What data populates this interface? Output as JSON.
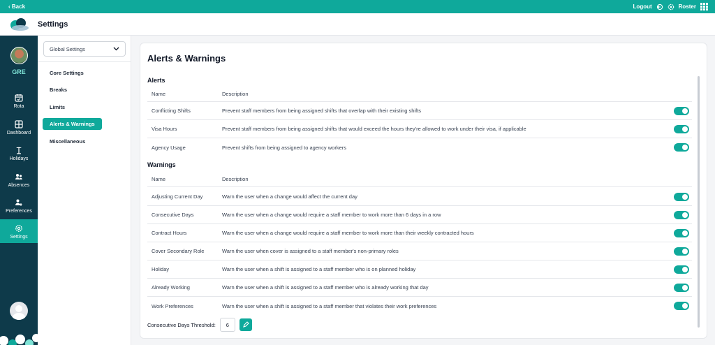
{
  "topbar": {
    "back_label": "Back",
    "logout_label": "Logout",
    "roster_label": "Roster"
  },
  "header": {
    "title": "Settings"
  },
  "nav": {
    "site_code": "GRE",
    "items": [
      {
        "label": "Rota",
        "icon": "calendar-icon"
      },
      {
        "label": "Dashboard",
        "icon": "dashboard-icon"
      },
      {
        "label": "Holidays",
        "icon": "holiday-icon"
      },
      {
        "label": "Absences",
        "icon": "absences-icon"
      },
      {
        "label": "Preferences",
        "icon": "preferences-icon"
      },
      {
        "label": "Settings",
        "icon": "gear-icon",
        "active": true
      }
    ]
  },
  "subnav": {
    "select_value": "Global Settings",
    "items": [
      {
        "label": "Core Settings"
      },
      {
        "label": "Breaks"
      },
      {
        "label": "Limits"
      },
      {
        "label": "Alerts & Warnings",
        "active": true
      },
      {
        "label": "Miscellaneous"
      }
    ]
  },
  "page": {
    "title": "Alerts & Warnings",
    "col_name": "Name",
    "col_description": "Description",
    "alerts": {
      "title": "Alerts",
      "rows": [
        {
          "name": "Conflicting Shifts",
          "description": "Prevent staff members from being assigned shifts that overlap with their existing shifts",
          "enabled": true
        },
        {
          "name": "Visa Hours",
          "description": "Prevent staff members from being assigned shifts that would exceed the hours they're allowed to work under their visa, if applicable",
          "enabled": true
        },
        {
          "name": "Agency Usage",
          "description": "Prevent shifts from being assigned to agency workers",
          "enabled": true
        }
      ]
    },
    "warnings": {
      "title": "Warnings",
      "rows": [
        {
          "name": "Adjusting Current Day",
          "description": "Warn the user when a change would affect the current day",
          "enabled": true
        },
        {
          "name": "Consecutive Days",
          "description": "Warn the user when a change would require a staff member to work more than 6 days in a row",
          "enabled": true
        },
        {
          "name": "Contract Hours",
          "description": "Warn the user when a change would require a staff member to work more than their weekly contracted hours",
          "enabled": true
        },
        {
          "name": "Cover Secondary Role",
          "description": "Warn the user when cover is assigned to a staff member's non-primary roles",
          "enabled": true
        },
        {
          "name": "Holiday",
          "description": "Warn the user when a shift is assigned to a staff member who is on planned holiday",
          "enabled": true
        },
        {
          "name": "Already Working",
          "description": "Warn the user when a shift is assigned to a staff member who is already working that day",
          "enabled": true
        },
        {
          "name": "Work Preferences",
          "description": "Warn the user when a shift is assigned to a staff member that violates their work preferences",
          "enabled": true
        }
      ]
    },
    "threshold_label": "Consecutive Days Threshold:",
    "threshold_value": "6"
  },
  "colors": {
    "accent": "#0fa99b",
    "nav_bg": "#0e3a4a"
  }
}
